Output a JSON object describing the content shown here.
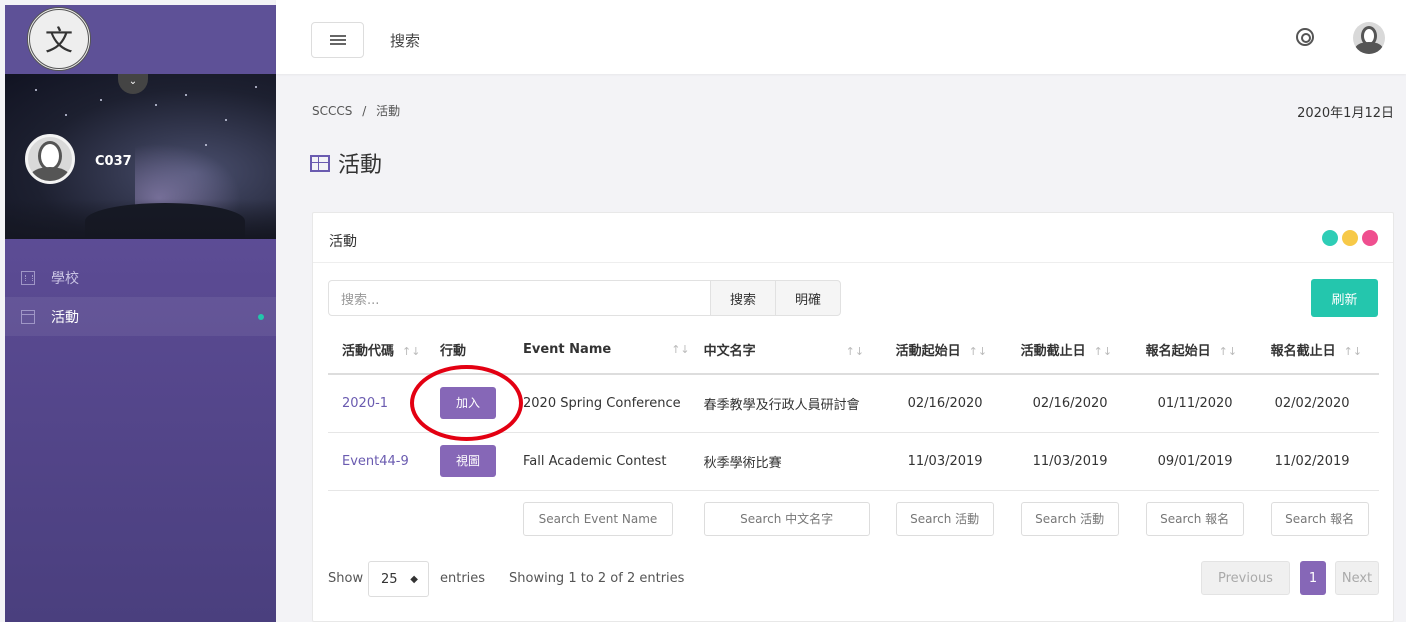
{
  "sidebar": {
    "logo_text": "文",
    "user": {
      "name": "C037"
    },
    "items": [
      {
        "label": "學校",
        "active": false
      },
      {
        "label": "活動",
        "active": true
      }
    ]
  },
  "topbar": {
    "search_label": "搜索"
  },
  "breadcrumb": {
    "root": "SCCCS",
    "sep": "/",
    "current": "活動"
  },
  "date": "2020年1月12日",
  "page_title": "活動",
  "card": {
    "title": "活動",
    "dot_colors": [
      "#2ecdb6",
      "#f7c948",
      "#ef4f8f"
    ],
    "search_placeholder": "搜索...",
    "search_button": "搜索",
    "clear_button": "明確",
    "refresh_button": "刷新"
  },
  "table": {
    "columns": [
      "活動代碼",
      "行動",
      "Event Name",
      "中文名字",
      "活動起始日",
      "活動截止日",
      "報名起始日",
      "報名截止日"
    ],
    "rows": [
      {
        "code": "2020-1",
        "action": "加入",
        "event_name": "2020 Spring Conference",
        "cn_name": "春季教學及行政人員研討會",
        "start": "02/16/2020",
        "end": "02/16/2020",
        "reg_start": "01/11/2020",
        "reg_end": "02/02/2020"
      },
      {
        "code": "Event44-9",
        "action": "視圖",
        "event_name": "Fall Academic Contest",
        "cn_name": "秋季學術比賽",
        "start": "11/03/2019",
        "end": "11/03/2019",
        "reg_start": "09/01/2019",
        "reg_end": "11/02/2019"
      }
    ],
    "filters": [
      "Search Event Name",
      "Search 中文名字",
      "Search 活動",
      "Search 活動",
      "Search 報名",
      "Search 報名"
    ]
  },
  "footer": {
    "show_label": "Show",
    "page_size": "25",
    "entries_label": "entries",
    "info": "Showing 1 to 2 of 2 entries",
    "prev": "Previous",
    "page": "1",
    "next": "Next"
  },
  "accent_color": "#8667b7",
  "teal_color": "#24c6ad",
  "highlight_color": "#e30012"
}
